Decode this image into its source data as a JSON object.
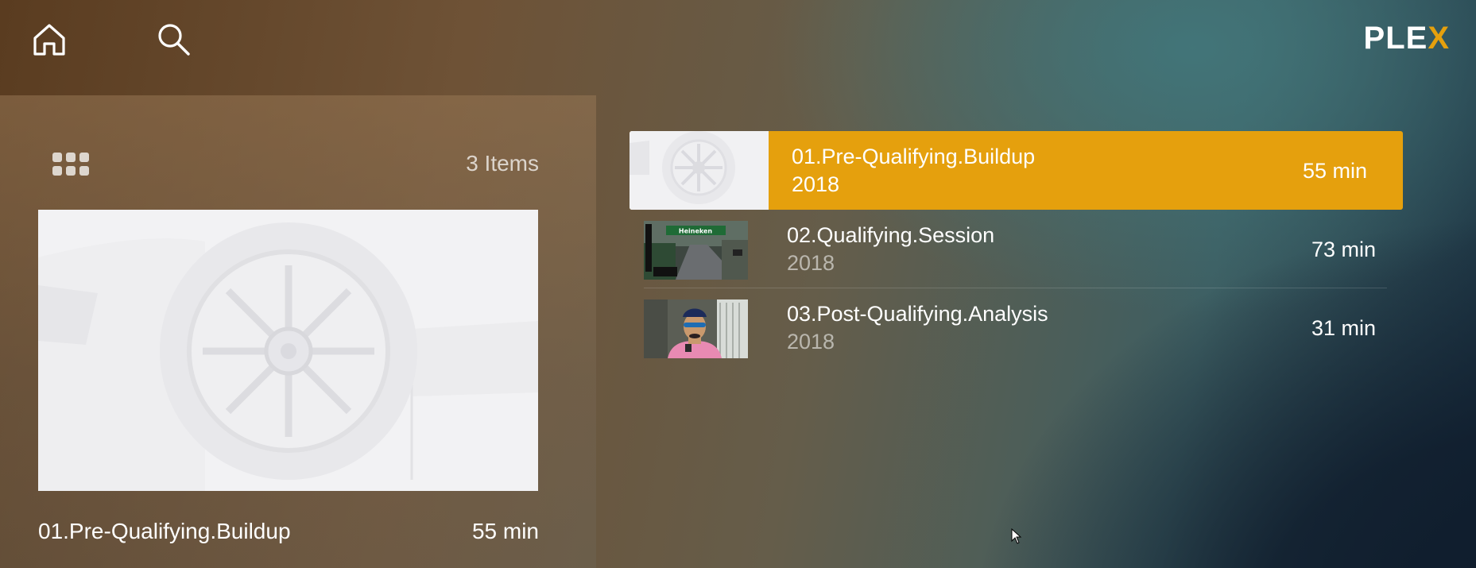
{
  "header": {
    "home_icon": "home-icon",
    "search_icon": "search-icon",
    "logo_main": "PLE",
    "logo_x": "X",
    "accent_color": "#e5a00d"
  },
  "panel": {
    "view_icon": "grid-icon",
    "item_count": "3 Items",
    "selected_title": "01.Pre-Qualifying.Buildup",
    "selected_duration": "55 min"
  },
  "items": [
    {
      "title": "01.Pre-Qualifying.Buildup",
      "year": "2018",
      "duration": "55 min",
      "selected": true
    },
    {
      "title": "02.Qualifying.Session",
      "year": "2018",
      "duration": "73 min",
      "selected": false
    },
    {
      "title": "03.Post-Qualifying.Analysis",
      "year": "2018",
      "duration": "31 min",
      "selected": false
    }
  ],
  "thumb_texts": {
    "sponsor": "Heineken"
  }
}
